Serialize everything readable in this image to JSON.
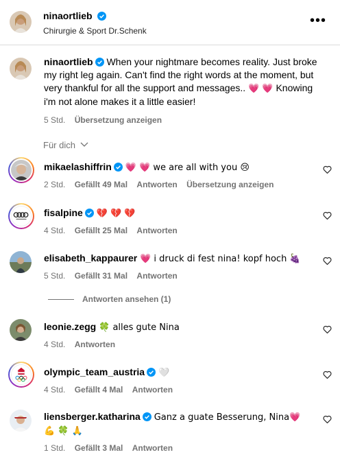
{
  "header": {
    "username": "ninaortlieb",
    "subtitle": "Chirurgie & Sport Dr.Schenk",
    "more_icon": "more-horizontal-icon"
  },
  "caption": {
    "username": "ninaortlieb",
    "text": "When your nightmare becomes reality. Just broke my right leg again. Can't find the right words at the moment, but very thankful for all the support and messages..",
    "emoji_1": "💗 💗",
    "text_2": "Knowing i'm not alone makes it a little easier!",
    "time": "5 Std.",
    "translate": "Übersetzung anzeigen"
  },
  "sort_label": "Für dich",
  "comments": [
    {
      "username": "mikaelashiffrin",
      "verified": true,
      "text": "💗 💗 we are all with you 😢",
      "time": "2 Std.",
      "likes": "Gefällt 49 Mal",
      "reply": "Antworten",
      "translate": "Übersetzung anzeigen"
    },
    {
      "username": "fisalpine",
      "verified": true,
      "text": "💔 💔 💔",
      "time": "4 Std.",
      "likes": "Gefällt 25 Mal",
      "reply": "Antworten"
    },
    {
      "username": "elisabeth_kappaurer",
      "verified": false,
      "text": "💗 i druck di fest nina! kopf hoch 🍇",
      "time": "5 Std.",
      "likes": "Gefällt 31 Mal",
      "reply": "Antworten"
    },
    {
      "username": "leonie.zegg",
      "verified": false,
      "text": "🍀 alles gute Nina",
      "time": "4 Std.",
      "reply": "Antworten"
    },
    {
      "username": "olympic_team_austria",
      "verified": true,
      "text": "🤍",
      "time": "4 Std.",
      "likes": "Gefällt 4 Mal",
      "reply": "Antworten"
    },
    {
      "username": "liensberger.katharina",
      "verified": true,
      "text": "Ganz a guate Besserung, Nina💗 💪 🍀 🙏",
      "time": "1 Std.",
      "likes": "Gefällt 3 Mal",
      "reply": "Antworten"
    }
  ],
  "view_replies": "Antworten ansehen (1)",
  "colors": {
    "verified": "#0095f6",
    "muted": "#737373",
    "border": "#dbdbdb"
  }
}
